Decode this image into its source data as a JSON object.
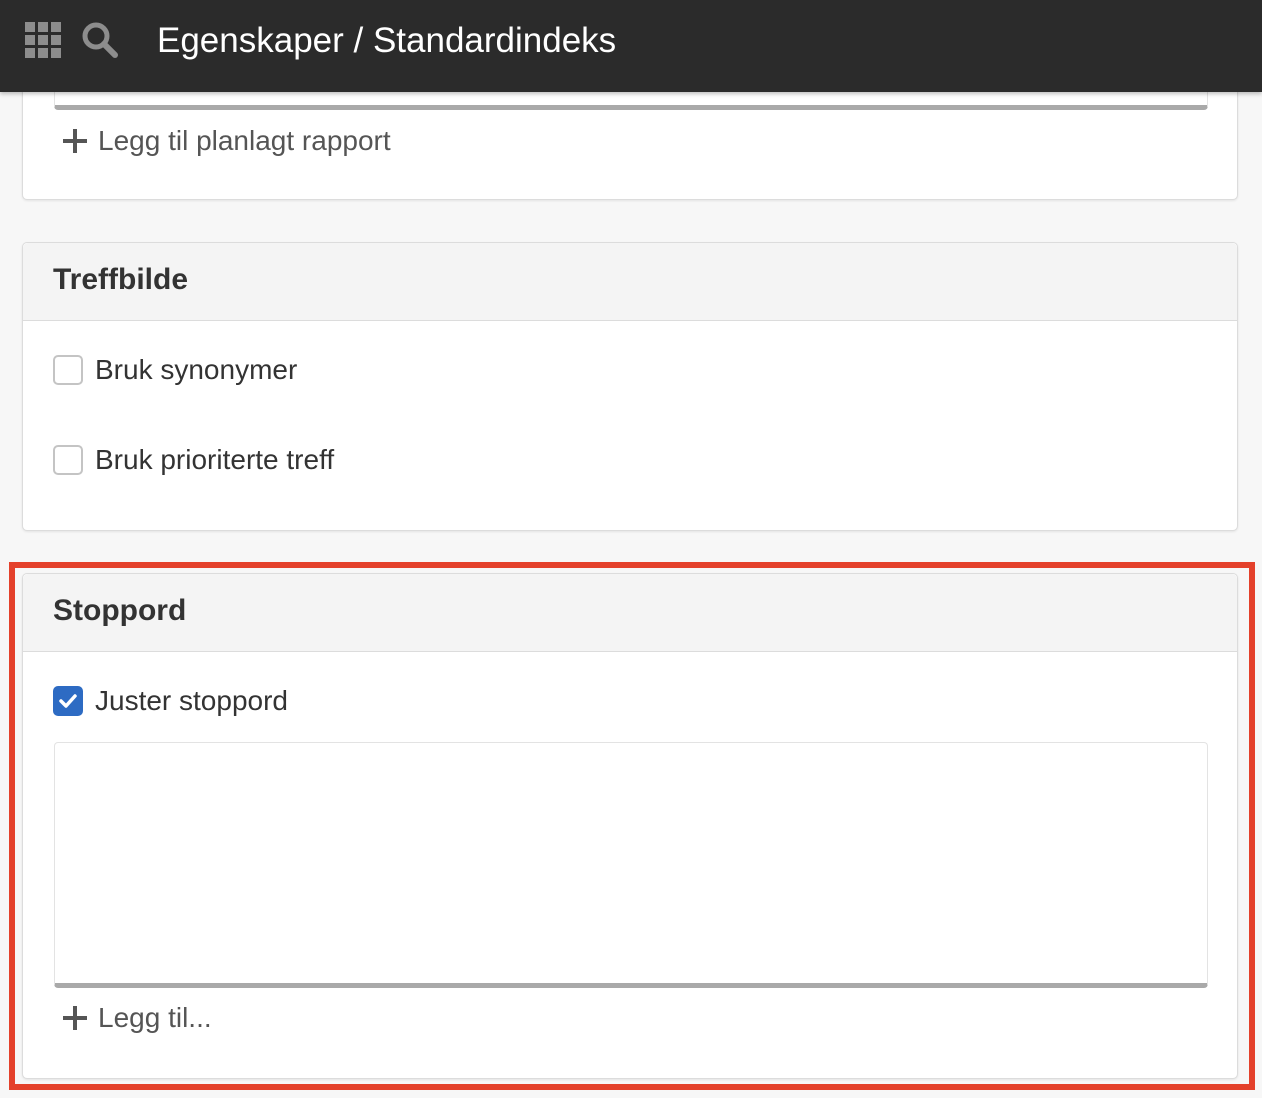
{
  "header": {
    "title": "Egenskaper / Standardindeks",
    "apps_icon": "grid-icon",
    "search_icon": "search-icon"
  },
  "reports_panel": {
    "add_label": "Legg til planlagt rapport"
  },
  "hits_panel": {
    "title": "Treffbilde",
    "options": [
      {
        "label": "Bruk synonymer",
        "checked": false
      },
      {
        "label": "Bruk prioriterte treff",
        "checked": false
      }
    ]
  },
  "stopwords_panel": {
    "title": "Stoppord",
    "adjust": {
      "label": "Juster stoppord",
      "checked": true
    },
    "list_items": [],
    "add_label": "Legg til..."
  },
  "colors": {
    "topbar": "#2b2b2b",
    "accent": "#2d6bc3",
    "highlight": "#e4412b"
  }
}
